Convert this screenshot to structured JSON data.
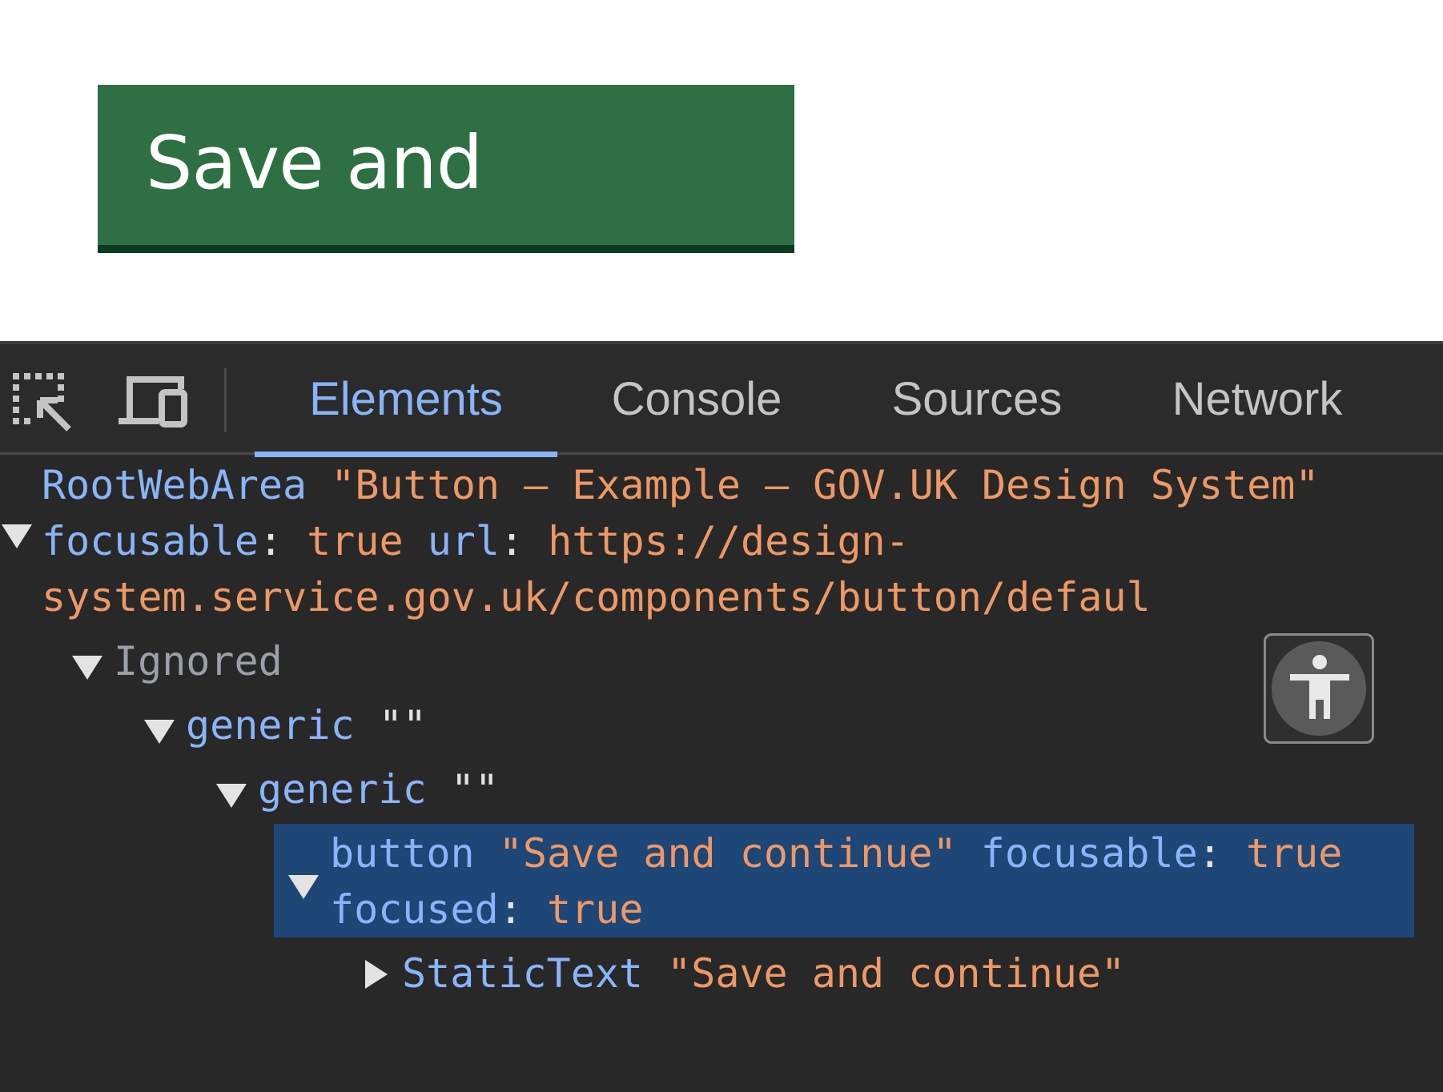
{
  "page": {
    "button_label": "Save and continue"
  },
  "devtools": {
    "tabs": [
      {
        "label": "Elements"
      },
      {
        "label": "Console"
      },
      {
        "label": "Sources"
      },
      {
        "label": "Network"
      }
    ],
    "active_tab": "Elements",
    "tree": {
      "root": {
        "role": "RootWebArea",
        "name": "\"Button – Example – GOV.UK Design System\"",
        "prop1_key": "focusable",
        "prop1_val": "true",
        "prop2_key": "url",
        "prop2_val_line1": "https://design-",
        "prop2_val_line2": "system.service.gov.uk/components/button/defaul"
      },
      "ignored": "Ignored",
      "generic1": {
        "role": "generic",
        "name": "\"\""
      },
      "generic2": {
        "role": "generic",
        "name": "\"\""
      },
      "button": {
        "role": "button",
        "name": "\"Save and continue\"",
        "prop1_key": "focusable",
        "prop1_val": "true",
        "prop2_key": "focused",
        "prop2_val": "true"
      },
      "statictext": {
        "role": "StaticText",
        "name": "\"Save and continue\""
      }
    },
    "colors": {
      "role": "#8ab4f8",
      "string": "#ee9866",
      "selected_bg": "#1e4677"
    }
  }
}
